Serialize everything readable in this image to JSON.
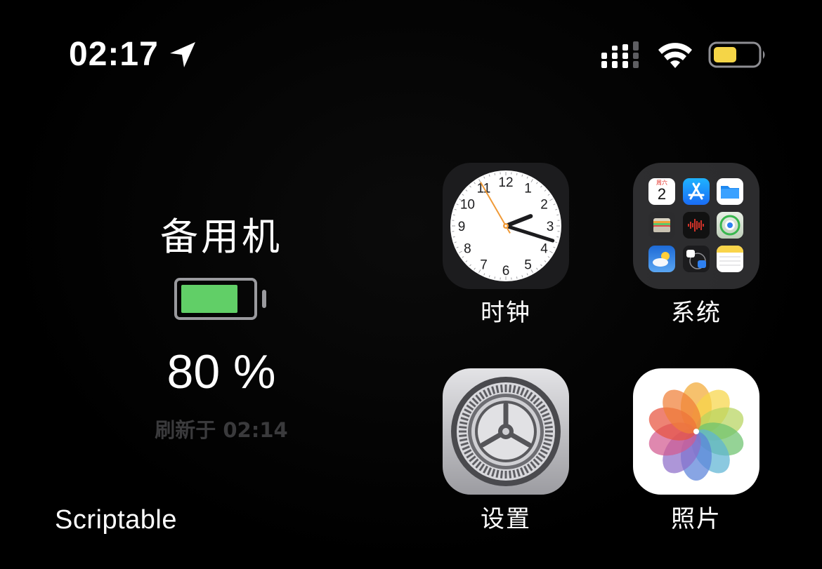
{
  "status_bar": {
    "time": "02:17",
    "icons": [
      "location-arrow-icon",
      "cellular-signal-icon",
      "wifi-icon",
      "battery-icon"
    ],
    "battery_color": "#f5d547"
  },
  "widget": {
    "title": "备用机",
    "battery_level_percent": 80,
    "battery_fill_color": "#61cf67",
    "percent_text": "80 %",
    "refresh_text": "刷新于 02:14",
    "app_label": "Scriptable"
  },
  "apps": {
    "clock": {
      "label": "时钟",
      "numerals": [
        "12",
        "1",
        "2",
        "3",
        "4",
        "5",
        "6",
        "7",
        "8",
        "9",
        "10",
        "11"
      ],
      "time_shown": {
        "hour": 2,
        "minute": 17,
        "second": 55
      },
      "second_hand_color": "#f09a37"
    },
    "folder": {
      "label": "系统",
      "calendar": {
        "day": "周六",
        "date": "2"
      },
      "contents": [
        "calendar-icon",
        "app-store-icon",
        "files-icon",
        "wallet-icon",
        "voice-memos-icon",
        "find-my-icon",
        "weather-icon",
        "translate-icon",
        "notes-icon"
      ]
    },
    "settings": {
      "label": "设置"
    },
    "photos": {
      "label": "照片",
      "petal_colors": [
        "#f3a934",
        "#f7d548",
        "#b7d45e",
        "#6cc26e",
        "#5eb4d4",
        "#5a82d9",
        "#8e6ec9",
        "#d25a90",
        "#e8533f",
        "#f07f38"
      ]
    }
  }
}
